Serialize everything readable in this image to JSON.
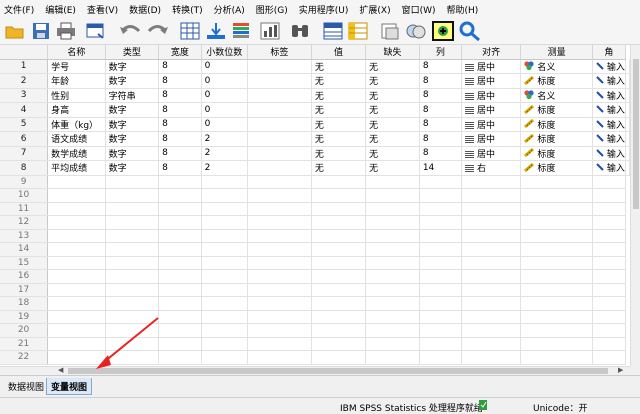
{
  "menu": [
    "文件(F)",
    "编辑(E)",
    "查看(V)",
    "数据(D)",
    "转换(T)",
    "分析(A)",
    "图形(G)",
    "实用程序(U)",
    "扩展(X)",
    "窗口(W)",
    "帮助(H)"
  ],
  "toolbar_icons": [
    "open-icon",
    "save-icon",
    "print-icon",
    "dialog-recall-icon",
    "undo-icon",
    "redo-icon",
    "goto-case-icon",
    "goto-variable-icon",
    "variables-icon",
    "run-descriptive-icon",
    "find-icon",
    "insert-cases-icon",
    "insert-variable-icon",
    "split-file-icon",
    "weight-cases-icon",
    "select-cases-icon",
    "value-labels-icon",
    "use-sets-icon",
    "search-icon"
  ],
  "columns": [
    "名称",
    "类型",
    "宽度",
    "小数位数",
    "标签",
    "值",
    "缺失",
    "列",
    "对齐",
    "测量",
    "角"
  ],
  "rows": [
    {
      "n": "1",
      "name": "学号",
      "type": "数字",
      "width": "8",
      "dec": "0",
      "label": "",
      "values": "无",
      "missing": "无",
      "cols": "8",
      "align": "居中",
      "measure": "名义",
      "mtype": "nominal",
      "role": "输入"
    },
    {
      "n": "2",
      "name": "年龄",
      "type": "数字",
      "width": "8",
      "dec": "0",
      "label": "",
      "values": "无",
      "missing": "无",
      "cols": "8",
      "align": "居中",
      "measure": "标度",
      "mtype": "scale",
      "role": "输入"
    },
    {
      "n": "3",
      "name": "性别",
      "type": "字符串",
      "width": "8",
      "dec": "0",
      "label": "",
      "values": "无",
      "missing": "无",
      "cols": "8",
      "align": "居中",
      "measure": "名义",
      "mtype": "nominal",
      "role": "输入"
    },
    {
      "n": "4",
      "name": "身高",
      "type": "数字",
      "width": "8",
      "dec": "0",
      "label": "",
      "values": "无",
      "missing": "无",
      "cols": "8",
      "align": "居中",
      "measure": "标度",
      "mtype": "scale",
      "role": "输入"
    },
    {
      "n": "5",
      "name": "体重（kg）",
      "type": "数字",
      "width": "8",
      "dec": "0",
      "label": "",
      "values": "无",
      "missing": "无",
      "cols": "8",
      "align": "居中",
      "measure": "标度",
      "mtype": "scale",
      "role": "输入"
    },
    {
      "n": "6",
      "name": "语文成绩",
      "type": "数字",
      "width": "8",
      "dec": "2",
      "label": "",
      "values": "无",
      "missing": "无",
      "cols": "8",
      "align": "居中",
      "measure": "标度",
      "mtype": "scale",
      "role": "输入"
    },
    {
      "n": "7",
      "name": "数学成绩",
      "type": "数字",
      "width": "8",
      "dec": "2",
      "label": "",
      "values": "无",
      "missing": "无",
      "cols": "8",
      "align": "居中",
      "measure": "标度",
      "mtype": "scale",
      "role": "输入"
    },
    {
      "n": "8",
      "name": "平均成绩",
      "type": "数字",
      "width": "8",
      "dec": "2",
      "label": "",
      "values": "无",
      "missing": "无",
      "cols": "14",
      "align": "右",
      "measure": "标度",
      "mtype": "scale",
      "role": "输入"
    }
  ],
  "empty_rows": [
    "9",
    "10",
    "11",
    "12",
    "13",
    "14",
    "15",
    "16",
    "17",
    "18",
    "19",
    "20",
    "21",
    "22"
  ],
  "tabs": {
    "data_view": "数据视图",
    "variable_view": "变量视图"
  },
  "status": {
    "processor": "IBM SPSS Statistics 处理程序就绪",
    "unicode": "Unicode：开"
  },
  "colors": {
    "header_bg": "#f3f3f3",
    "active_tab": "#dbe8f7",
    "annotation_arrow": "#e8231f"
  }
}
